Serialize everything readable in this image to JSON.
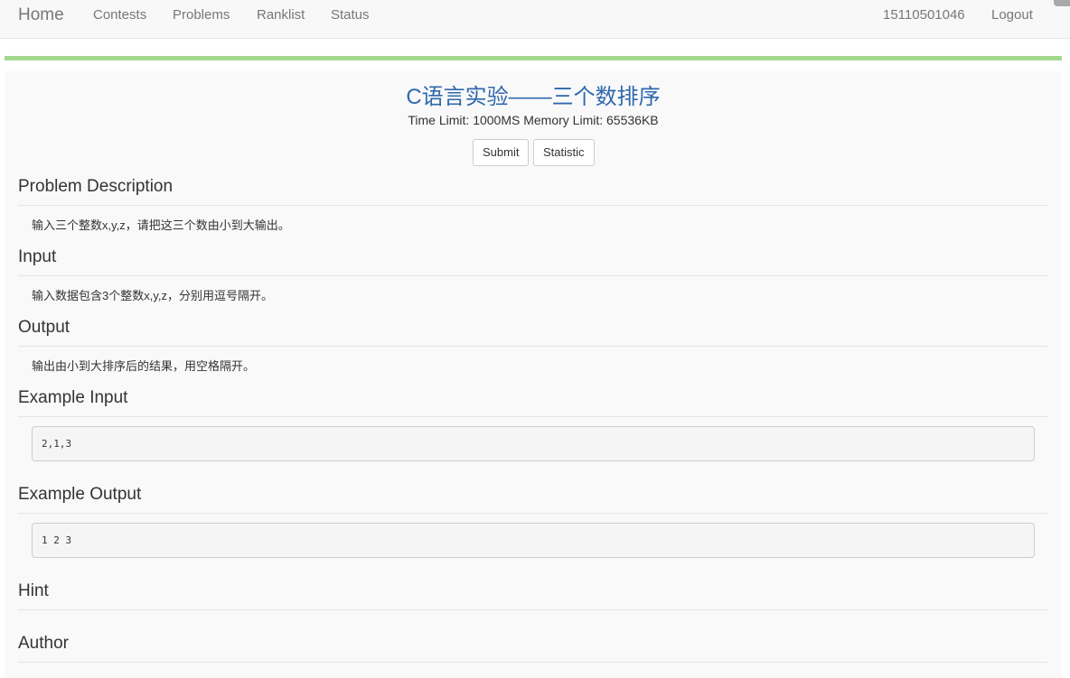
{
  "nav": {
    "brand": "Home",
    "links": [
      "Contests",
      "Problems",
      "Ranklist",
      "Status"
    ],
    "user": "15110501046",
    "logout": "Logout"
  },
  "problem": {
    "title": "C语言实验——三个数排序",
    "limits": "Time Limit: 1000MS Memory Limit: 65536KB",
    "buttons": {
      "submit": "Submit",
      "statistic": "Statistic"
    },
    "sections": {
      "description_head": "Problem Description",
      "description_text": "输入三个整数x,y,z，请把这三个数由小到大输出。",
      "input_head": "Input",
      "input_text": "输入数据包含3个整数x,y,z，分别用逗号隔开。",
      "output_head": "Output",
      "output_text": "输出由小到大排序后的结果，用空格隔开。",
      "example_input_head": "Example Input",
      "example_input": "2,1,3",
      "example_output_head": "Example Output",
      "example_output": "1 2 3",
      "hint_head": "Hint",
      "author_head": "Author"
    }
  },
  "colors": {
    "title": "#2e68ad",
    "progress": "#a4d88f",
    "nav_text": "#777777"
  }
}
